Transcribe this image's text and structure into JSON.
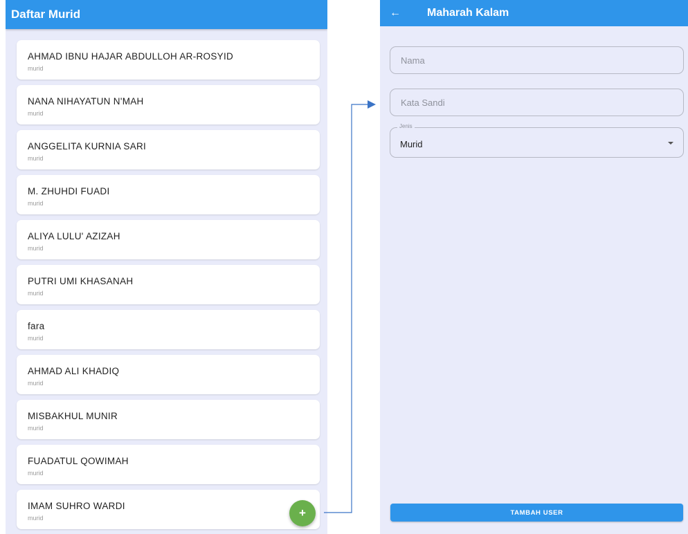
{
  "left": {
    "appbar": {
      "title": "Daftar Murid"
    },
    "students": [
      {
        "name": "AHMAD IBNU HAJAR ABDULLOH AR-ROSYID",
        "role": "murid"
      },
      {
        "name": "NANA NIHAYATUN N'MAH",
        "role": "murid"
      },
      {
        "name": "ANGGELITA KURNIA SARI",
        "role": "murid"
      },
      {
        "name": "M. ZHUHDI FUADI",
        "role": "murid"
      },
      {
        "name": "ALIYA LULU' AZIZAH",
        "role": "murid"
      },
      {
        "name": "PUTRI UMI KHASANAH",
        "role": "murid"
      },
      {
        "name": "fara",
        "role": "murid"
      },
      {
        "name": "AHMAD ALI KHADIQ",
        "role": "murid"
      },
      {
        "name": "MISBAKHUL MUNIR",
        "role": "murid"
      },
      {
        "name": "FUADATUL QOWIMAH",
        "role": "murid"
      },
      {
        "name": "IMAM SUHRO WARDI",
        "role": "murid"
      }
    ],
    "fab": {
      "label": "+",
      "icon": "plus-icon",
      "color": "#6ab04c"
    }
  },
  "right": {
    "appbar": {
      "title": "Maharah Kalam",
      "back_icon": "arrow-left-icon",
      "back_glyph": "←"
    },
    "form": {
      "nama_placeholder": "Nama",
      "nama_value": "",
      "sandi_placeholder": "Kata Sandi",
      "sandi_value": "",
      "jenis_label": "Jenis",
      "jenis_value": "Murid"
    },
    "submit_label": "TAMBAH USER"
  },
  "colors": {
    "primary": "#2f95ea",
    "background": "#e9ebfa",
    "connector": "#3b74c6"
  }
}
